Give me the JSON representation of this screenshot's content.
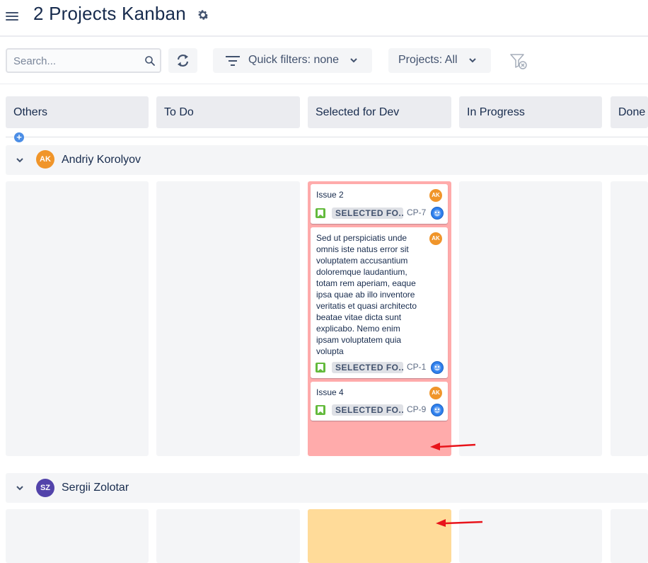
{
  "header": {
    "title": "2 Projects Kanban"
  },
  "toolbar": {
    "search_placeholder": "Search...",
    "search_value": "",
    "quick_filters_label": "Quick filters: none",
    "projects_label": "Projects: All"
  },
  "columns": [
    {
      "label": "Others"
    },
    {
      "label": "To Do"
    },
    {
      "label": "Selected for Dev"
    },
    {
      "label": "In Progress"
    },
    {
      "label": "Done"
    }
  ],
  "swimlanes": [
    {
      "assignee": "Andriy Korolyov",
      "initials": "AK",
      "avatar_color": "#f0952a",
      "highlight_color": "#ffabab",
      "cards": [
        {
          "summary": "Issue 2",
          "status": "SELECTED FO...",
          "key": "CP-7",
          "assignee_initials": "AK"
        },
        {
          "summary": "Sed ut perspiciatis unde omnis iste natus error sit voluptatem accusantium doloremque laudantium, totam rem aperiam, eaque ipsa quae ab illo inventore veritatis et quasi architecto beatae vitae dicta sunt explicabo. Nemo enim ipsam voluptatem quia volupta",
          "status": "SELECTED FO...",
          "key": "CP-1",
          "assignee_initials": "AK"
        },
        {
          "summary": "Issue 4",
          "status": "SELECTED FO...",
          "key": "CP-9",
          "assignee_initials": "AK"
        }
      ]
    },
    {
      "assignee": "Sergii Zolotar",
      "initials": "SZ",
      "avatar_color": "#5243aa",
      "highlight_color": "#ffdb99",
      "cards": []
    }
  ],
  "colors": {
    "accent": "#4c8ee6",
    "story": "#63ba3c",
    "annotation_arrow": "#e8141b"
  }
}
